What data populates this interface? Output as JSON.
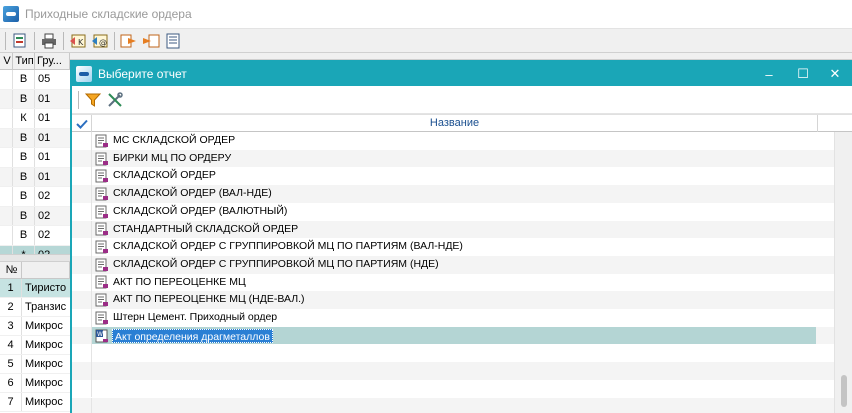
{
  "background_window": {
    "title": "Приходные складские ордера",
    "top_grid": {
      "headers": [
        "V",
        "Тип",
        "Гру..."
      ],
      "rows": [
        {
          "v": "",
          "type": "В",
          "group": "05"
        },
        {
          "v": "",
          "type": "В",
          "group": "01"
        },
        {
          "v": "",
          "type": "К",
          "group": "01"
        },
        {
          "v": "",
          "type": "В",
          "group": "01"
        },
        {
          "v": "",
          "type": "В",
          "group": "01"
        },
        {
          "v": "",
          "type": "В",
          "group": "01"
        },
        {
          "v": "",
          "type": "В",
          "group": "02"
        },
        {
          "v": "",
          "type": "В",
          "group": "02"
        },
        {
          "v": "",
          "type": "В",
          "group": "02"
        },
        {
          "v": "",
          "type": "*",
          "group": "02"
        }
      ]
    },
    "bottom_grid": {
      "headers": [
        "№",
        ""
      ],
      "rows": [
        {
          "no": "1",
          "name": "Тиристо"
        },
        {
          "no": "2",
          "name": "Транзис"
        },
        {
          "no": "3",
          "name": "Микрос"
        },
        {
          "no": "4",
          "name": "Микрос"
        },
        {
          "no": "5",
          "name": "Микрос"
        },
        {
          "no": "6",
          "name": "Микрос"
        },
        {
          "no": "7",
          "name": "Микрос"
        }
      ]
    }
  },
  "dialog": {
    "title": "Выберите отчет",
    "controls": {
      "minimize": "‒",
      "maximize": "☐",
      "close": "✕"
    },
    "toolbar": [
      {
        "name": "filter-icon"
      },
      {
        "name": "tools-icon"
      }
    ],
    "column_header": "Название",
    "reports": [
      {
        "label": "МС СКЛАДСКОЙ ОРДЕР",
        "icon": "report-icon"
      },
      {
        "label": "БИРКИ МЦ ПО ОРДЕРУ",
        "icon": "report-icon"
      },
      {
        "label": "СКЛАДСКОЙ ОРДЕР",
        "icon": "report-icon"
      },
      {
        "label": "СКЛАДСКОЙ ОРДЕР (ВАЛ-НДЕ)",
        "icon": "report-icon"
      },
      {
        "label": "СКЛАДСКОЙ ОРДЕР (ВАЛЮТНЫЙ)",
        "icon": "report-icon"
      },
      {
        "label": "СТАНДАРТНЫЙ СКЛАДСКОЙ ОРДЕР",
        "icon": "report-icon"
      },
      {
        "label": "СКЛАДСКОЙ ОРДЕР С ГРУППИРОВКОЙ МЦ ПО ПАРТИЯМ (ВАЛ-НДЕ)",
        "icon": "report-icon"
      },
      {
        "label": "СКЛАДСКОЙ ОРДЕР С ГРУППИРОВКОЙ МЦ ПО ПАРТИЯМ (НДЕ)",
        "icon": "report-icon"
      },
      {
        "label": "АКТ ПО ПЕРЕОЦЕНКЕ МЦ",
        "icon": "report-icon"
      },
      {
        "label": "АКТ ПО ПЕРЕОЦЕНКЕ МЦ (НДЕ-ВАЛ.)",
        "icon": "report-icon"
      },
      {
        "label": "Штерн Цемент. Приходный ордер",
        "icon": "report-icon"
      },
      {
        "label": "Акт определения драгметаллов",
        "icon": "word-report-icon",
        "selected": true
      }
    ],
    "empty_rows": 4
  },
  "colors": {
    "dialog_accent": "#1aa6b7",
    "selection": "#2a7fd4",
    "selected_row": "#b4d5d4"
  }
}
